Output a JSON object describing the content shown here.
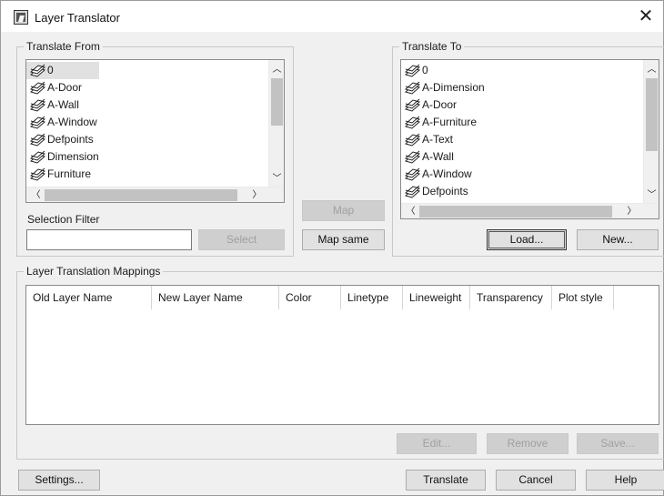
{
  "window": {
    "title": "Layer Translator",
    "close_glyph": "✕"
  },
  "from": {
    "legend": "Translate From",
    "items": [
      {
        "label": "0",
        "selected": true
      },
      {
        "label": "A-Door"
      },
      {
        "label": "A-Wall"
      },
      {
        "label": "A-Window"
      },
      {
        "label": "Defpoints"
      },
      {
        "label": "Dimension"
      },
      {
        "label": "Furniture"
      }
    ],
    "selection_filter_label": "Selection Filter",
    "selection_filter_value": "",
    "select_button": "Select"
  },
  "to": {
    "legend": "Translate To",
    "items": [
      {
        "label": "0"
      },
      {
        "label": "A-Dimension"
      },
      {
        "label": "A-Door"
      },
      {
        "label": "A-Furniture"
      },
      {
        "label": "A-Text"
      },
      {
        "label": "A-Wall"
      },
      {
        "label": "A-Window"
      },
      {
        "label": "Defpoints"
      }
    ],
    "load_button": "Load...",
    "new_button": "New..."
  },
  "middle": {
    "map_button": "Map",
    "map_same_button": "Map same"
  },
  "mappings": {
    "legend": "Layer Translation Mappings",
    "columns": [
      "Old Layer Name",
      "New Layer Name",
      "Color",
      "Linetype",
      "Lineweight",
      "Transparency",
      "Plot style"
    ],
    "edit_button": "Edit...",
    "remove_button": "Remove",
    "save_button": "Save..."
  },
  "footer": {
    "settings_button": "Settings...",
    "translate_button": "Translate",
    "cancel_button": "Cancel",
    "help_button": "Help"
  },
  "icons": {
    "layer": "layer-stack-icon",
    "app": "layer-translator-app-icon",
    "close": "close-icon"
  },
  "colors": {
    "window_bg": "#f0f0f0",
    "selection_bg": "#e1e1e1",
    "disabled_text": "#a0a0a0"
  }
}
